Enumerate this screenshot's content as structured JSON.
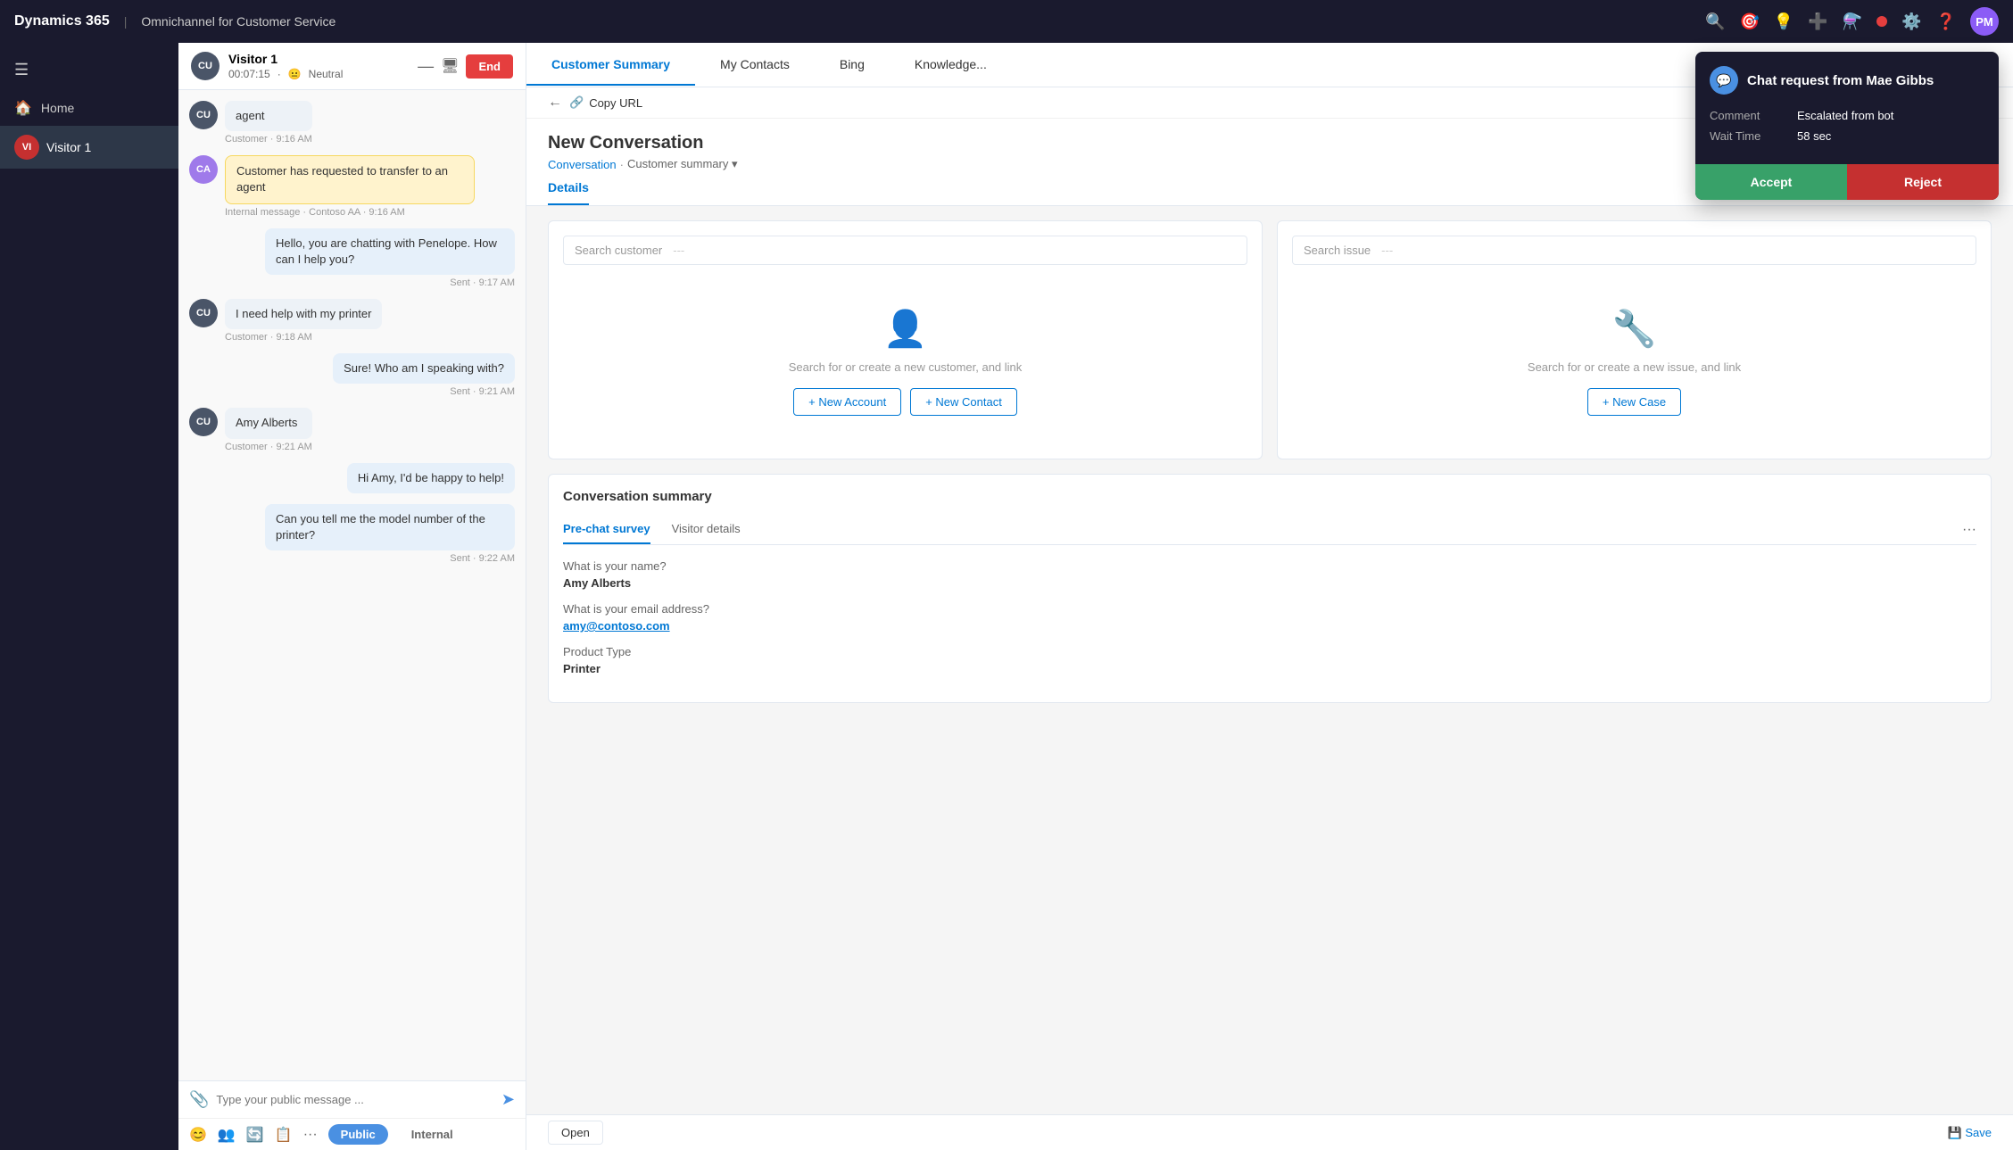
{
  "topnav": {
    "brand": "Dynamics 365",
    "divider": "|",
    "app_name": "Omnichannel for Customer Service",
    "avatar_initials": "PM"
  },
  "sidebar": {
    "menu_icon": "☰",
    "home_label": "Home",
    "visitor_label": "Visitor 1",
    "visitor_initials": "VI"
  },
  "chat": {
    "visitor_name": "Visitor 1",
    "timer": "00:07:15",
    "sentiment": "Neutral",
    "minimize_icon": "—",
    "end_label": "End",
    "messages": [
      {
        "id": 1,
        "type": "agent-label",
        "text": "agent",
        "avatar": "CU",
        "time": "Customer · 9:16 AM"
      },
      {
        "id": 2,
        "type": "internal",
        "text": "Customer has requested to transfer to an agent",
        "time": "Internal message · Contoso AA · 9:16 AM"
      },
      {
        "id": 3,
        "type": "agent-sent",
        "text": "Hello, you are chatting with Penelope. How can I help you?",
        "time": "Sent · 9:17 AM"
      },
      {
        "id": 4,
        "type": "customer",
        "text": "I need help with my printer",
        "avatar": "CU",
        "time": "Customer · 9:18 AM"
      },
      {
        "id": 5,
        "type": "agent-sent",
        "text": "Sure! Who am I speaking with?",
        "time": "Sent · 9:21 AM"
      },
      {
        "id": 6,
        "type": "customer",
        "text": "Amy Alberts",
        "avatar": "CU",
        "time": "Customer · 9:21 AM"
      },
      {
        "id": 7,
        "type": "agent-sent",
        "text": "Hi Amy, I'd be happy to help!",
        "time": ""
      },
      {
        "id": 8,
        "type": "agent-sent",
        "text": "Can you tell me the model number of the printer?",
        "time": "Sent · 9:22 AM"
      }
    ],
    "input_placeholder": "Type your public message ...",
    "attach_icon": "📎",
    "send_icon": "➤",
    "tab_public": "Public",
    "tab_internal": "Internal"
  },
  "tabs": {
    "items": [
      {
        "label": "Customer Summary",
        "active": true
      },
      {
        "label": "My Contacts",
        "active": false
      },
      {
        "label": "Bing",
        "active": false
      },
      {
        "label": "Knowledge...",
        "active": false
      }
    ]
  },
  "conversation": {
    "title": "New Conversation",
    "breadcrumb_link": "Conversation",
    "breadcrumb_current": "Customer summary",
    "back_icon": "←",
    "copy_url_icon": "🔗",
    "copy_url_label": "Copy URL",
    "details_tab": "Details",
    "details_tab_active": true
  },
  "customer_card": {
    "search_placeholder": "Search customer",
    "search_dashes": "---",
    "empty_icon": "👤",
    "empty_text": "Search for or create a new customer, and link",
    "btn_new_account": "+ New Account",
    "btn_new_contact": "+ New Contact"
  },
  "issue_card": {
    "search_placeholder": "Search issue",
    "search_dashes": "---",
    "empty_icon": "🔧",
    "empty_text": "Search for or create a new issue, and link",
    "btn_new_case": "+ New Case"
  },
  "conversation_summary": {
    "title": "Conversation summary",
    "tab_prechat": "Pre-chat survey",
    "tab_visitor": "Visitor details",
    "tab_more": "···",
    "fields": [
      {
        "question": "What is your name?",
        "answer": "Amy Alberts",
        "is_link": false
      },
      {
        "question": "What is your email address?",
        "answer": "amy@contoso.com",
        "is_link": true
      },
      {
        "question": "Product Type",
        "answer": "Printer",
        "is_link": false
      }
    ]
  },
  "chat_request_popup": {
    "avatar": "💬",
    "title": "Chat request from Mae Gibbs",
    "comment_label": "Comment",
    "comment_value": "Escalated from bot",
    "wait_time_label": "Wait Time",
    "wait_time_value": "58 sec",
    "accept_label": "Accept",
    "reject_label": "Reject"
  },
  "bottom_bar": {
    "status_label": "Open",
    "save_label": "💾 Save"
  }
}
